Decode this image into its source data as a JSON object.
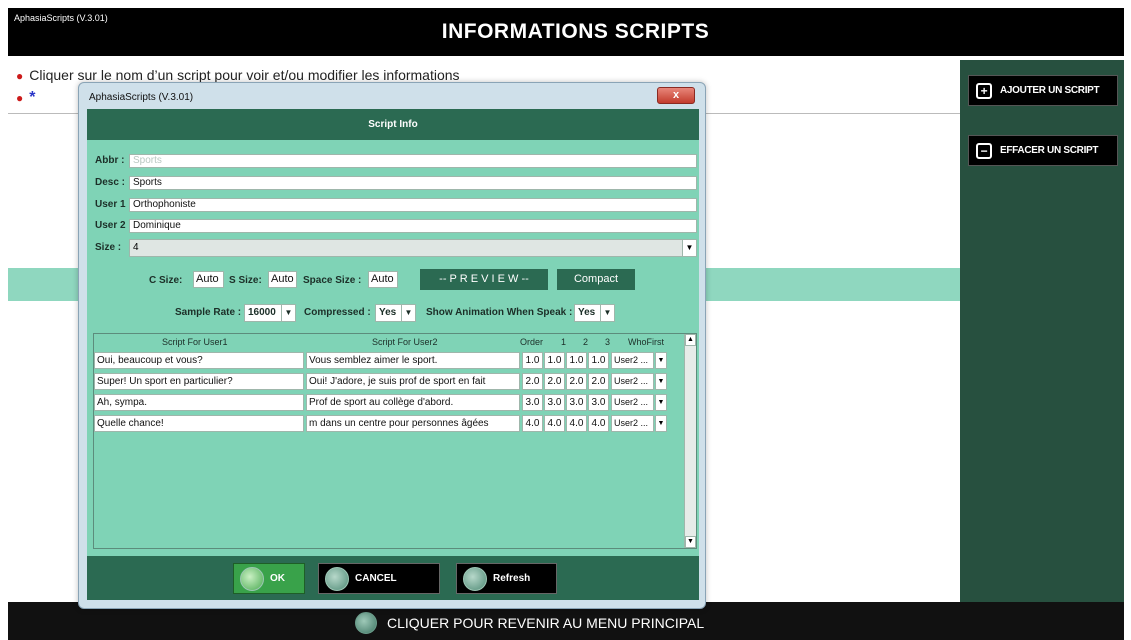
{
  "app": {
    "small_title": "AphasiaScripts (V.3.01)",
    "main_title": "INFORMATIONS SCRIPTS"
  },
  "instructions": {
    "line1": "Cliquer sur le nom d’un script pour voir et/ou modifier les informations",
    "line2_symbol": "*"
  },
  "side_buttons": {
    "add": "AJOUTER UN SCRIPT",
    "delete": "EFFACER UN SCRIPT"
  },
  "bottom": {
    "return_label": "CLIQUER POUR REVENIR AU MENU PRINCIPAL"
  },
  "dialog": {
    "window_title": "AphasiaScripts (V.3.01)",
    "close_label": "x",
    "header": "Script Info",
    "fields": {
      "abbr_label": "Abbr :",
      "abbr_value": "Sports",
      "desc_label": "Desc :",
      "desc_value": "Sports",
      "user1_label": "User 1 :",
      "user1_value": "Orthophoniste",
      "user2_label": "User 2 :",
      "user2_value": "Dominique",
      "size_label": "Size :",
      "size_value": "4"
    },
    "controls": {
      "c_size_label": "C Size:",
      "c_size_value": "Auto",
      "s_size_label": "S Size:",
      "s_size_value": "Auto",
      "space_size_label": "Space Size :",
      "space_size_value": "Auto",
      "preview_label": "-- P R E V I E W --",
      "compact_label": "Compact",
      "sample_rate_label": "Sample Rate :",
      "sample_rate_value": "16000",
      "compressed_label": "Compressed :",
      "compressed_value": "Yes",
      "show_anim_label": "Show Animation When Speak :",
      "show_anim_value": "Yes"
    },
    "table": {
      "headers": {
        "user1": "Script For User1",
        "user2": "Script For User2",
        "order": "Order",
        "c1": "1",
        "c2": "2",
        "c3": "3",
        "who": "WhoFirst"
      },
      "rows": [
        {
          "u1": "Oui, beaucoup et vous?",
          "u2": "Vous semblez aimer le sport.",
          "o": "1.0",
          "a": "1.0",
          "b": "1.0",
          "c": "1.0",
          "who": "User2 ..."
        },
        {
          "u1": "Super! Un sport en particulier?",
          "u2": "Oui! J'adore, je suis prof de sport en fait",
          "o": "2.0",
          "a": "2.0",
          "b": "2.0",
          "c": "2.0",
          "who": "User2 ..."
        },
        {
          "u1": "Ah, sympa.",
          "u2": "Prof de sport au collège d'abord.",
          "o": "3.0",
          "a": "3.0",
          "b": "3.0",
          "c": "3.0",
          "who": "User2 ..."
        },
        {
          "u1": "Quelle chance!",
          "u2": "m dans un centre pour personnes âgées",
          "o": "4.0",
          "a": "4.0",
          "b": "4.0",
          "c": "4.0",
          "who": "User2 ..."
        }
      ]
    },
    "footer": {
      "ok": "OK",
      "cancel": "CANCEL",
      "refresh": "Refresh"
    }
  }
}
